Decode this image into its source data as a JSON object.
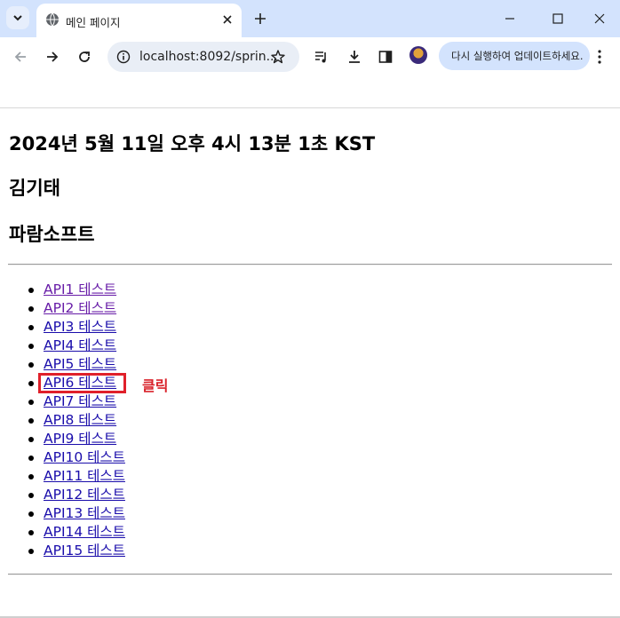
{
  "browser": {
    "tab_title": "메인 페이지",
    "url": "localhost:8092/sprin...",
    "update_button_label": "다시 실행하여 업데이트하세요.",
    "icons": [
      "tab-search-icon",
      "globe-icon",
      "close-icon",
      "plus-icon",
      "minimize-icon",
      "maximize-icon",
      "close-window-icon",
      "back-arrow-icon",
      "forward-arrow-icon",
      "reload-icon",
      "info-icon",
      "star-icon",
      "media-icon",
      "download-icon",
      "side-panel-icon",
      "profile-icon",
      "more-icon"
    ]
  },
  "page": {
    "datetime": "2024년 5월 11일 오후 4시 13분 1초 KST",
    "name": "김기태",
    "company": "파람소프트",
    "links": [
      {
        "label": "API1 테스트",
        "visited": true
      },
      {
        "label": "API2 테스트",
        "visited": true
      },
      {
        "label": "API3 테스트",
        "visited": false
      },
      {
        "label": "API4 테스트",
        "visited": false
      },
      {
        "label": "API5 테스트",
        "visited": false
      },
      {
        "label": "API6 테스트",
        "visited": false
      },
      {
        "label": "API7 테스트",
        "visited": false
      },
      {
        "label": "API8 테스트",
        "visited": false
      },
      {
        "label": "API9 테스트",
        "visited": false
      },
      {
        "label": "API10 테스트",
        "visited": false
      },
      {
        "label": "API11 테스트",
        "visited": false
      },
      {
        "label": "API12 테스트",
        "visited": false
      },
      {
        "label": "API13 테스트",
        "visited": false
      },
      {
        "label": "API14 테스트",
        "visited": false
      },
      {
        "label": "API15 테스트",
        "visited": false
      }
    ]
  },
  "annotation": {
    "label": "클릭",
    "target_index": 5,
    "color": "#e0202a"
  }
}
